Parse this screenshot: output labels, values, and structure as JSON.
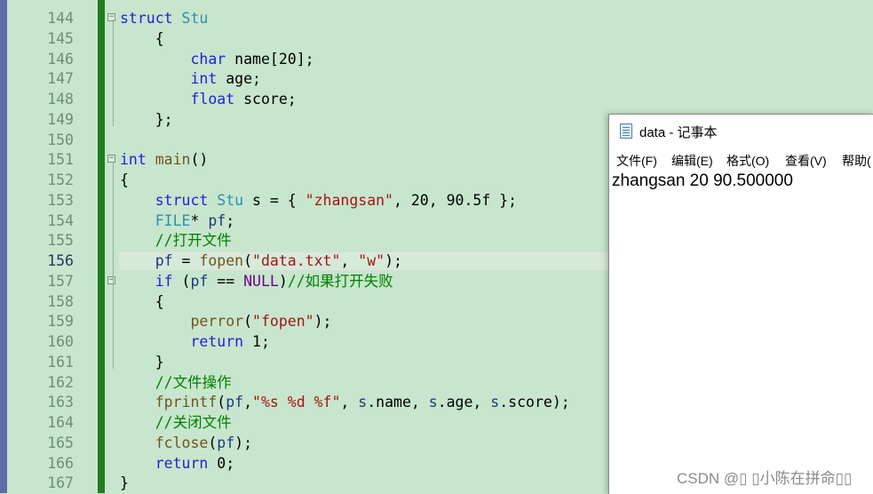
{
  "editor": {
    "current_line": "156",
    "lines": [
      {
        "num": "144",
        "fold": "⊟",
        "parts": [
          [
            "kw",
            "struct"
          ],
          [
            "",
            "",
            " "
          ],
          [
            "ty",
            "Stu"
          ]
        ]
      },
      {
        "num": "145",
        "parts": [
          [
            "",
            "    {"
          ]
        ]
      },
      {
        "num": "146",
        "parts": [
          [
            "",
            "        "
          ],
          [
            "kw",
            "char"
          ],
          [
            "",
            " name[20];"
          ]
        ]
      },
      {
        "num": "147",
        "parts": [
          [
            "",
            "        "
          ],
          [
            "kw",
            "int"
          ],
          [
            "",
            " age;"
          ]
        ]
      },
      {
        "num": "148",
        "parts": [
          [
            "",
            "        "
          ],
          [
            "kw",
            "float"
          ],
          [
            "",
            " score;"
          ]
        ]
      },
      {
        "num": "149",
        "parts": [
          [
            "",
            "    };"
          ]
        ]
      },
      {
        "num": "150",
        "parts": []
      },
      {
        "num": "151",
        "fold": "⊟",
        "parts": [
          [
            "kw",
            "int"
          ],
          [
            "",
            " "
          ],
          [
            "fn",
            "main"
          ],
          [
            "",
            "()"
          ]
        ]
      },
      {
        "num": "152",
        "parts": [
          [
            "",
            "{"
          ]
        ]
      },
      {
        "num": "153",
        "parts": [
          [
            "",
            "    "
          ],
          [
            "kw",
            "struct"
          ],
          [
            "",
            " "
          ],
          [
            "ty",
            "Stu"
          ],
          [
            "",
            " s = { "
          ],
          [
            "st",
            "\"zhangsan\""
          ],
          [
            "",
            ", 20, 90.5f };"
          ]
        ]
      },
      {
        "num": "154",
        "parts": [
          [
            "",
            "    "
          ],
          [
            "ty",
            "FILE"
          ],
          [
            "",
            "* "
          ],
          [
            "var",
            "pf"
          ],
          [
            "",
            ";"
          ]
        ]
      },
      {
        "num": "155",
        "parts": [
          [
            "",
            "    "
          ],
          [
            "cm",
            "//打开文件"
          ]
        ]
      },
      {
        "num": "156",
        "parts": [
          [
            "",
            "    "
          ],
          [
            "var",
            "pf"
          ],
          [
            "",
            " = "
          ],
          [
            "fn",
            "fopen"
          ],
          [
            "",
            "("
          ],
          [
            "st",
            "\"data.txt\""
          ],
          [
            "",
            ", "
          ],
          [
            "st",
            "\"w\""
          ],
          [
            "",
            ");"
          ]
        ]
      },
      {
        "num": "157",
        "fold": "⊟",
        "parts": [
          [
            "",
            "    "
          ],
          [
            "kw",
            "if"
          ],
          [
            "",
            " ("
          ],
          [
            "var",
            "pf"
          ],
          [
            "",
            " == "
          ],
          [
            "mac",
            "NULL"
          ],
          [
            "",
            ")"
          ],
          [
            "cm",
            "//如果打开失败"
          ]
        ]
      },
      {
        "num": "158",
        "parts": [
          [
            "",
            "    {"
          ]
        ]
      },
      {
        "num": "159",
        "parts": [
          [
            "",
            "        "
          ],
          [
            "fn",
            "perror"
          ],
          [
            "",
            "("
          ],
          [
            "st",
            "\"fopen\""
          ],
          [
            "",
            ");"
          ]
        ]
      },
      {
        "num": "160",
        "parts": [
          [
            "",
            "        "
          ],
          [
            "kw",
            "return"
          ],
          [
            "",
            " 1;"
          ]
        ]
      },
      {
        "num": "161",
        "parts": [
          [
            "",
            "    }"
          ]
        ]
      },
      {
        "num": "162",
        "parts": [
          [
            "",
            "    "
          ],
          [
            "cm",
            "//文件操作"
          ]
        ]
      },
      {
        "num": "163",
        "parts": [
          [
            "",
            "    "
          ],
          [
            "fn",
            "fprintf"
          ],
          [
            "",
            "("
          ],
          [
            "var",
            "pf"
          ],
          [
            "",
            ","
          ],
          [
            "st",
            "\"%s %d %f\""
          ],
          [
            "",
            ", "
          ],
          [
            "var",
            "s"
          ],
          [
            "",
            ".name, "
          ],
          [
            "var",
            "s"
          ],
          [
            "",
            ".age, "
          ],
          [
            "var",
            "s"
          ],
          [
            "",
            ".score);"
          ]
        ]
      },
      {
        "num": "164",
        "parts": [
          [
            "",
            "    "
          ],
          [
            "cm",
            "//关闭文件"
          ]
        ]
      },
      {
        "num": "165",
        "parts": [
          [
            "",
            "    "
          ],
          [
            "fn",
            "fclose"
          ],
          [
            "",
            "("
          ],
          [
            "var",
            "pf"
          ],
          [
            "",
            ");"
          ]
        ]
      },
      {
        "num": "166",
        "parts": [
          [
            "",
            "    "
          ],
          [
            "kw",
            "return"
          ],
          [
            "",
            " 0;"
          ]
        ]
      },
      {
        "num": "167",
        "parts": [
          [
            "",
            "}"
          ]
        ]
      }
    ],
    "colors": {
      "keyword": "#1f1fdd",
      "type": "#2b91af",
      "string": "#a31515",
      "comment": "#008000",
      "macro": "#6f008a",
      "function": "#74531f",
      "background": "#c7e6cd",
      "change_bar": "#1e7d21"
    }
  },
  "notepad": {
    "title": "data - 记事本",
    "menu": [
      "文件(F)",
      "编辑(E)",
      "格式(O)",
      "查看(V)",
      "帮助("
    ],
    "content": "zhangsan 20 90.500000",
    "icon": "notepad-icon"
  },
  "watermark": "CSDN @\u0000 \u0000小陈在拼命\u0000\u0000"
}
